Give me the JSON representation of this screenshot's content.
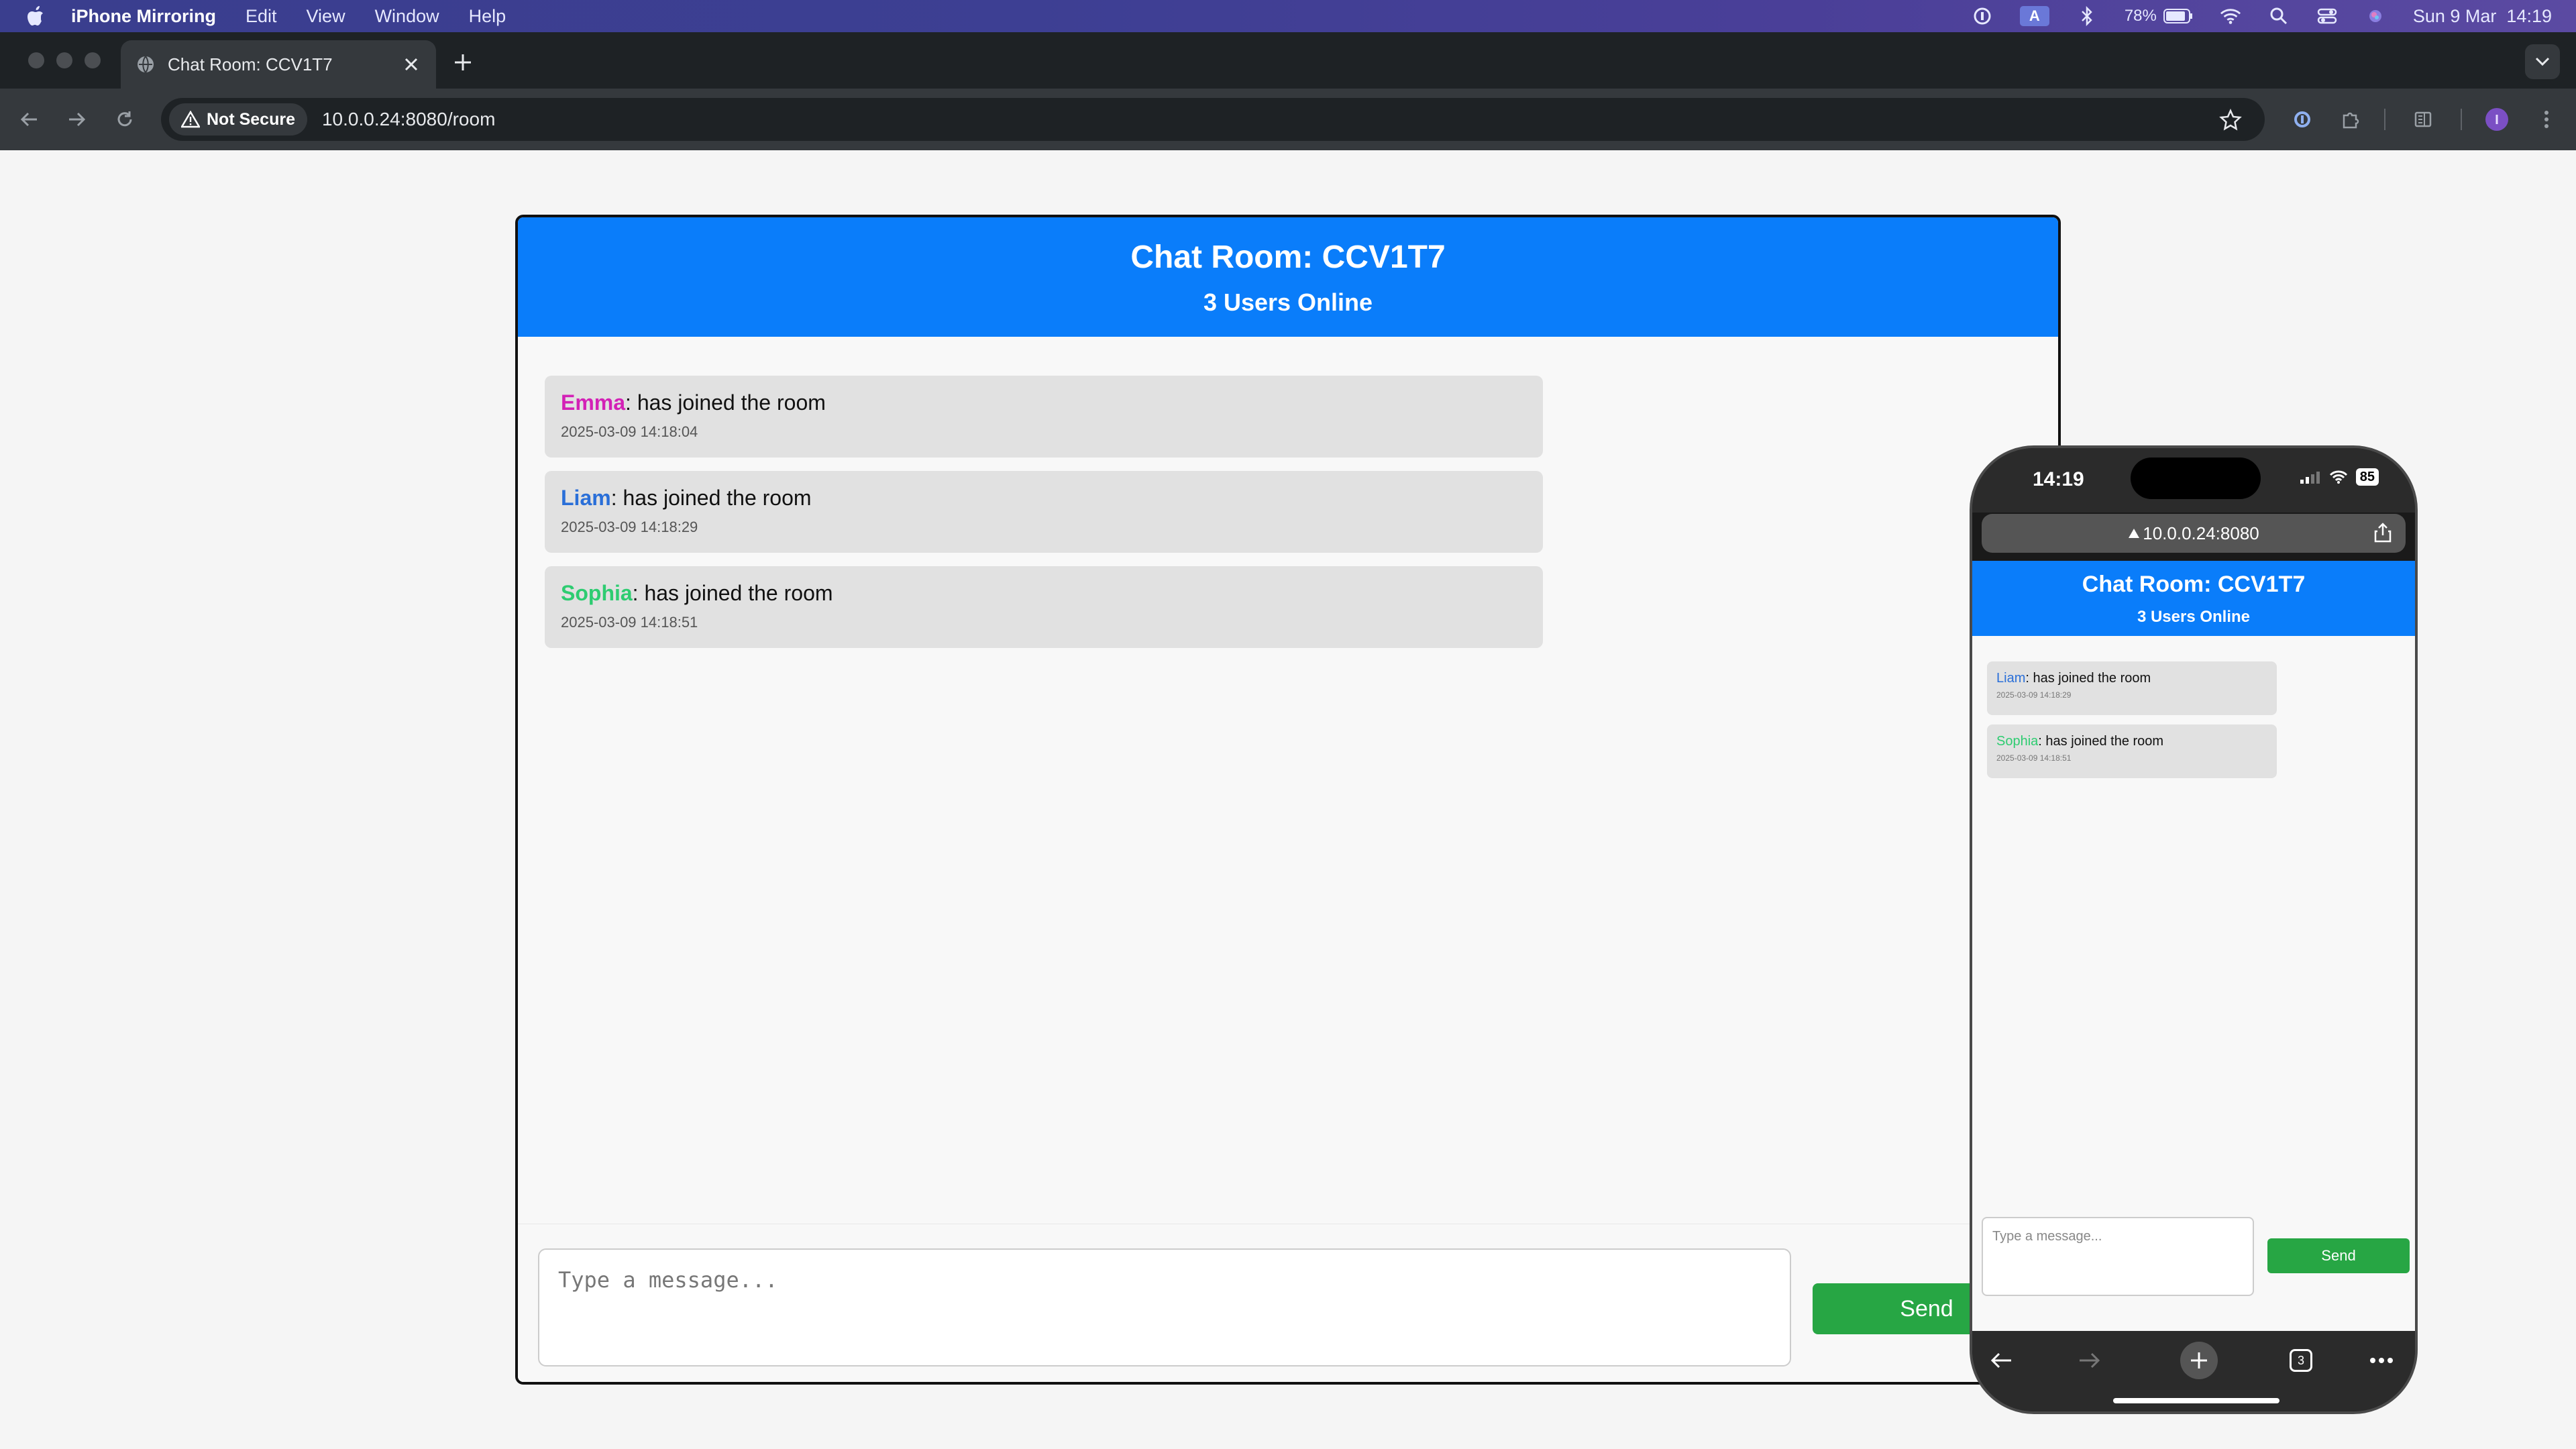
{
  "menubar": {
    "app_name": "iPhone Mirroring",
    "items": [
      "Edit",
      "View",
      "Window",
      "Help"
    ],
    "battery": "78%",
    "datetime": "Sun 9 Mar  14:19",
    "input_badge": "A"
  },
  "browser": {
    "tab_title": "Chat Room: CCV1T7",
    "security_label": "Not Secure",
    "url": "10.0.0.24:8080/room"
  },
  "chat": {
    "title": "Chat Room: CCV1T7",
    "subtitle": "3 Users Online",
    "messages": [
      {
        "user": "Emma",
        "color": "#d321b6",
        "text": ": has joined the room",
        "time": "2025-03-09 14:18:04"
      },
      {
        "user": "Liam",
        "color": "#2a6fd8",
        "text": ": has joined the room",
        "time": "2025-03-09 14:18:29"
      },
      {
        "user": "Sophia",
        "color": "#2ecc71",
        "text": ": has joined the room",
        "time": "2025-03-09 14:18:51"
      }
    ],
    "input_placeholder": "Type a message...",
    "send_label": "Send"
  },
  "phone": {
    "time": "14:19",
    "battery": "85",
    "url": "10.0.0.24:8080",
    "title": "Chat Room: CCV1T7",
    "subtitle": "3 Users Online",
    "messages": [
      {
        "user": "Liam",
        "color": "#2a6fd8",
        "text": ": has joined the room",
        "time": "2025-03-09 14:18:29"
      },
      {
        "user": "Sophia",
        "color": "#2ecc71",
        "text": ": has joined the room",
        "time": "2025-03-09 14:18:51"
      }
    ],
    "input_placeholder": "Type a message...",
    "send_label": "Send",
    "tab_count": "3"
  },
  "colors": {
    "header_blue": "#0a7dfa",
    "send_green": "#27a644"
  }
}
